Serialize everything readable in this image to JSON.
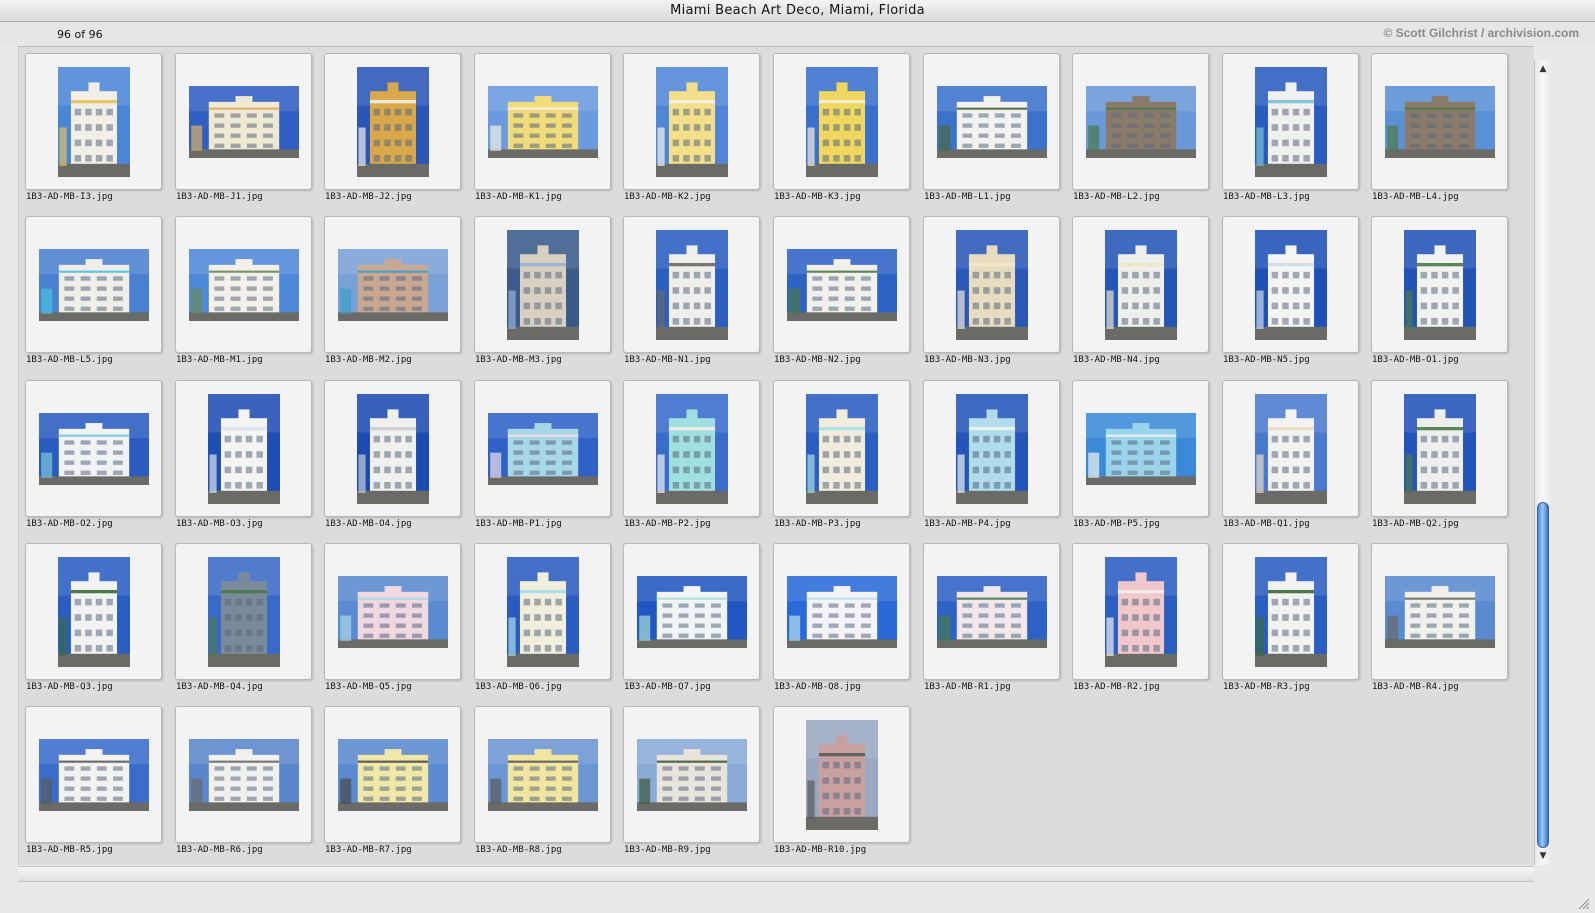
{
  "window": {
    "title": "Miami Beach Art Deco, Miami, Florida"
  },
  "toolbar": {
    "count": "96 of 96",
    "credit": "© Scott Gilchrist / archivision.com"
  },
  "thumbnails": [
    {
      "file": "1B3-AD-MB-I3.jpg",
      "orient": "p",
      "sky": "#4a86d6",
      "bld": "#f1efe6",
      "acc": "#e5c05a"
    },
    {
      "file": "1B3-AD-MB-J1.jpg",
      "orient": "l",
      "sky": "#2f5fc2",
      "bld": "#efe8d2",
      "acc": "#d8b060"
    },
    {
      "file": "1B3-AD-MB-J2.jpg",
      "orient": "p",
      "sky": "#2a56b8",
      "bld": "#d9a84a",
      "acc": "#f2efe4"
    },
    {
      "file": "1B3-AD-MB-K1.jpg",
      "orient": "l",
      "sky": "#6a9ae0",
      "bld": "#f0dc7a",
      "acc": "#f5f1e2"
    },
    {
      "file": "1B3-AD-MB-K2.jpg",
      "orient": "p",
      "sky": "#4f86d8",
      "bld": "#f4e08a",
      "acc": "#f5f3ea"
    },
    {
      "file": "1B3-AD-MB-K3.jpg",
      "orient": "p",
      "sky": "#3a70cc",
      "bld": "#f0d860",
      "acc": "#f6f0d6"
    },
    {
      "file": "1B3-AD-MB-L1.jpg",
      "orient": "l",
      "sky": "#3a72cc",
      "bld": "#f2f2f0",
      "acc": "#4a6a3a"
    },
    {
      "file": "1B3-AD-MB-L2.jpg",
      "orient": "l",
      "sky": "#6a98d8",
      "bld": "#8a7a6a",
      "acc": "#4a7a4a"
    },
    {
      "file": "1B3-AD-MB-L3.jpg",
      "orient": "p",
      "sky": "#2a5cc0",
      "bld": "#f0f0ee",
      "acc": "#7ac0d6"
    },
    {
      "file": "1B3-AD-MB-L4.jpg",
      "orient": "l",
      "sky": "#5a90d6",
      "bld": "#8a7a68",
      "acc": "#4e7a46"
    },
    {
      "file": "1B3-AD-MB-L5.jpg",
      "orient": "l",
      "sky": "#4a80d0",
      "bld": "#f0eee8",
      "acc": "#4ac0e0"
    },
    {
      "file": "1B3-AD-MB-M1.jpg",
      "orient": "l",
      "sky": "#4e88d8",
      "bld": "#f2f0e8",
      "acc": "#6a8a5a"
    },
    {
      "file": "1B3-AD-MB-M2.jpg",
      "orient": "l",
      "sky": "#7aa0d8",
      "bld": "#c8a890",
      "acc": "#3aa0c8"
    },
    {
      "file": "1B3-AD-MB-M3.jpg",
      "orient": "p",
      "sky": "#3a5a8a",
      "bld": "#d8d0c0",
      "acc": "#9ab0d8"
    },
    {
      "file": "1B3-AD-MB-N1.jpg",
      "orient": "p",
      "sky": "#2a5ec0",
      "bld": "#f0eeea",
      "acc": "#6a6a6a"
    },
    {
      "file": "1B3-AD-MB-N2.jpg",
      "orient": "l",
      "sky": "#2e62c4",
      "bld": "#f2f0ec",
      "acc": "#4a7a4a"
    },
    {
      "file": "1B3-AD-MB-N3.jpg",
      "orient": "p",
      "sky": "#2a58b8",
      "bld": "#e8dcc0",
      "acc": "#f0e8d0"
    },
    {
      "file": "1B3-AD-MB-N4.jpg",
      "orient": "p",
      "sky": "#2456b8",
      "bld": "#eeeeea",
      "acc": "#f0e6c8"
    },
    {
      "file": "1B3-AD-MB-N5.jpg",
      "orient": "p",
      "sky": "#1e50b6",
      "bld": "#f4f4f4",
      "acc": "#d0d8e8"
    },
    {
      "file": "1B3-AD-MB-O1.jpg",
      "orient": "p",
      "sky": "#2254b8",
      "bld": "#f2f2f0",
      "acc": "#4a7a4a"
    },
    {
      "file": "1B3-AD-MB-O2.jpg",
      "orient": "l",
      "sky": "#2a5cc0",
      "bld": "#f0f2f4",
      "acc": "#7ac8d8"
    },
    {
      "file": "1B3-AD-MB-O3.jpg",
      "orient": "p",
      "sky": "#1e4eb4",
      "bld": "#f4f4f2",
      "acc": "#dce4ee"
    },
    {
      "file": "1B3-AD-MB-O4.jpg",
      "orient": "p",
      "sky": "#1c4cb2",
      "bld": "#f0f0ee",
      "acc": "#c8ccd4"
    },
    {
      "file": "1B3-AD-MB-P1.jpg",
      "orient": "l",
      "sky": "#2e62c6",
      "bld": "#a8d8e8",
      "acc": "#f0e0e8"
    },
    {
      "file": "1B3-AD-MB-P2.jpg",
      "orient": "p",
      "sky": "#3a6ccc",
      "bld": "#a0e0e0",
      "acc": "#f4f0e8"
    },
    {
      "file": "1B3-AD-MB-P3.jpg",
      "orient": "p",
      "sky": "#2a5ec2",
      "bld": "#f2ecdc",
      "acc": "#a8e0e4"
    },
    {
      "file": "1B3-AD-MB-P4.jpg",
      "orient": "p",
      "sky": "#2456ba",
      "bld": "#b0dcec",
      "acc": "#f0f0f0"
    },
    {
      "file": "1B3-AD-MB-P5.jpg",
      "orient": "l",
      "sky": "#3a8ad8",
      "bld": "#9ad4ec",
      "acc": "#f4f4f4"
    },
    {
      "file": "1B3-AD-MB-Q1.jpg",
      "orient": "p",
      "sky": "#4a7ad0",
      "bld": "#f2f2f0",
      "acc": "#e8dcc0"
    },
    {
      "file": "1B3-AD-MB-Q2.jpg",
      "orient": "p",
      "sky": "#2254ba",
      "bld": "#eeeeec",
      "acc": "#4a7a4a"
    },
    {
      "file": "1B3-AD-MB-Q3.jpg",
      "orient": "p",
      "sky": "#2a5ec2",
      "bld": "#f2f2f2",
      "acc": "#3a6a3a"
    },
    {
      "file": "1B3-AD-MB-Q4.jpg",
      "orient": "p",
      "sky": "#3a6ac8",
      "bld": "#7a8a9a",
      "acc": "#4a7a4a"
    },
    {
      "file": "1B3-AD-MB-Q5.jpg",
      "orient": "l",
      "sky": "#5a8ad0",
      "bld": "#f0d8e0",
      "acc": "#a8d8e8"
    },
    {
      "file": "1B3-AD-MB-Q6.jpg",
      "orient": "p",
      "sky": "#2a5cc0",
      "bld": "#f2eedc",
      "acc": "#a8dcec"
    },
    {
      "file": "1B3-AD-MB-Q7.jpg",
      "orient": "l",
      "sky": "#2256c0",
      "bld": "#f0f4f4",
      "acc": "#a8e0d8"
    },
    {
      "file": "1B3-AD-MB-Q8.jpg",
      "orient": "l",
      "sky": "#2a6ad8",
      "bld": "#f4f4f8",
      "acc": "#b8e0f0"
    },
    {
      "file": "1B3-AD-MB-R1.jpg",
      "orient": "l",
      "sky": "#2e62c6",
      "bld": "#f0e8ec",
      "acc": "#4a7a4a"
    },
    {
      "file": "1B3-AD-MB-R2.jpg",
      "orient": "p",
      "sky": "#2a5ec2",
      "bld": "#f0c8cc",
      "acc": "#f4f0ec"
    },
    {
      "file": "1B3-AD-MB-R3.jpg",
      "orient": "p",
      "sky": "#2a5ec2",
      "bld": "#f2f2f0",
      "acc": "#3a6a3a"
    },
    {
      "file": "1B3-AD-MB-R4.jpg",
      "orient": "l",
      "sky": "#5a8ad0",
      "bld": "#f0f0ec",
      "acc": "#6a6a6a"
    },
    {
      "file": "1B3-AD-MB-R5.jpg",
      "orient": "l",
      "sky": "#3a6ccc",
      "bld": "#f2f2f0",
      "acc": "#5a5a5a"
    },
    {
      "file": "1B3-AD-MB-R6.jpg",
      "orient": "l",
      "sky": "#5a86cc",
      "bld": "#f0f0ee",
      "acc": "#6a6a6a"
    },
    {
      "file": "1B3-AD-MB-R7.jpg",
      "orient": "l",
      "sky": "#5a8ad0",
      "bld": "#f0e8a8",
      "acc": "#4a4a4a"
    },
    {
      "file": "1B3-AD-MB-R8.jpg",
      "orient": "l",
      "sky": "#6a96d4",
      "bld": "#f0e6a0",
      "acc": "#5a5a5a"
    },
    {
      "file": "1B3-AD-MB-R9.jpg",
      "orient": "l",
      "sky": "#8aaad8",
      "bld": "#e8e4dc",
      "acc": "#3a5a3a"
    },
    {
      "file": "1B3-AD-MB-R10.jpg",
      "orient": "p",
      "sky": "#9aa8c0",
      "bld": "#c8a0a0",
      "acc": "#5a5a5a"
    }
  ]
}
